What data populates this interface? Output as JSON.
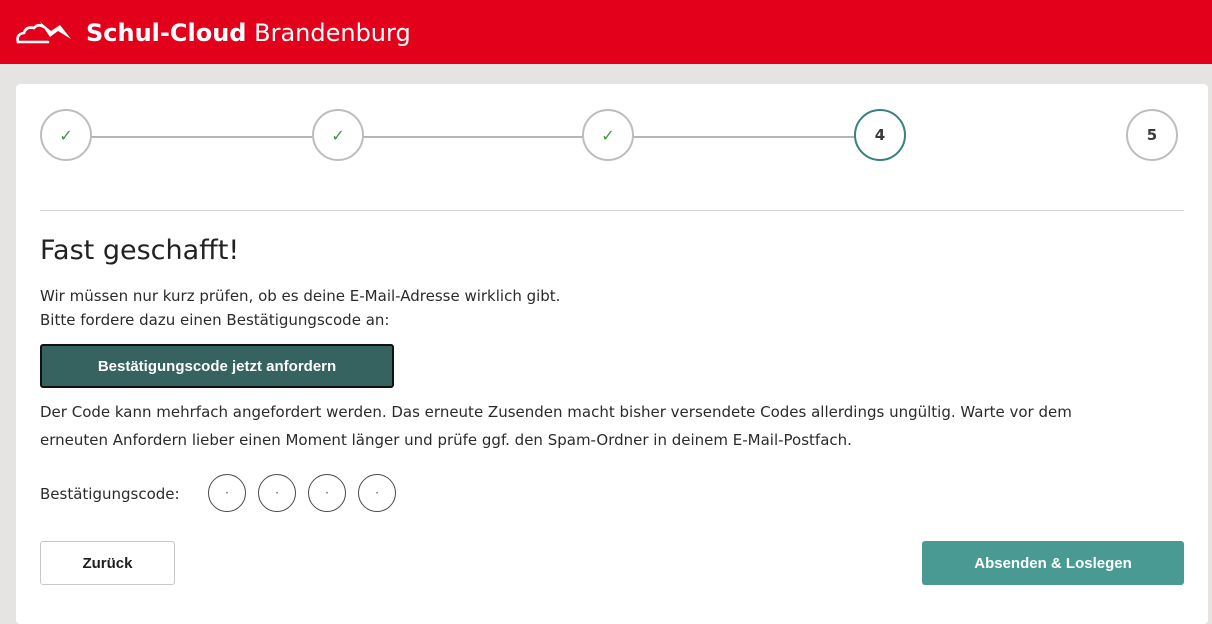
{
  "header": {
    "brand_strong": "Schul-Cloud",
    "brand_light": "Brandenburg",
    "logo_icon": "cloud-bird-logo-icon",
    "background_color": "#e3001b"
  },
  "stepper": {
    "steps": [
      {
        "label": "✓",
        "state": "done"
      },
      {
        "label": "✓",
        "state": "done"
      },
      {
        "label": "✓",
        "state": "done"
      },
      {
        "label": "4",
        "state": "active"
      },
      {
        "label": "5",
        "state": "pending"
      }
    ],
    "active_color": "#37807c",
    "done_color": "#3c9a3a"
  },
  "main": {
    "title": "Fast geschafft!",
    "intro_line1": "Wir müssen nur kurz prüfen, ob es deine E-Mail-Adresse wirklich gibt.",
    "intro_line2": "Bitte fordere dazu einen Bestätigungscode an:",
    "request_button": "Bestätigungscode jetzt anfordern",
    "note_line1": "Der Code kann mehrfach angefordert werden. Das erneute Zusenden macht bisher versendete Codes allerdings ungültig. Warte vor dem",
    "note_line2": "erneuten Anfordern lieber einen Moment länger und prüfe ggf. den Spam-Ordner in deinem E-Mail-Postfach.",
    "code_label": "Bestätigungscode:",
    "code_placeholders": [
      "·",
      "·",
      "·",
      "·"
    ]
  },
  "footer": {
    "back_button": "Zurück",
    "submit_button": "Absenden & Loslegen",
    "submit_color": "#4a9a94"
  }
}
